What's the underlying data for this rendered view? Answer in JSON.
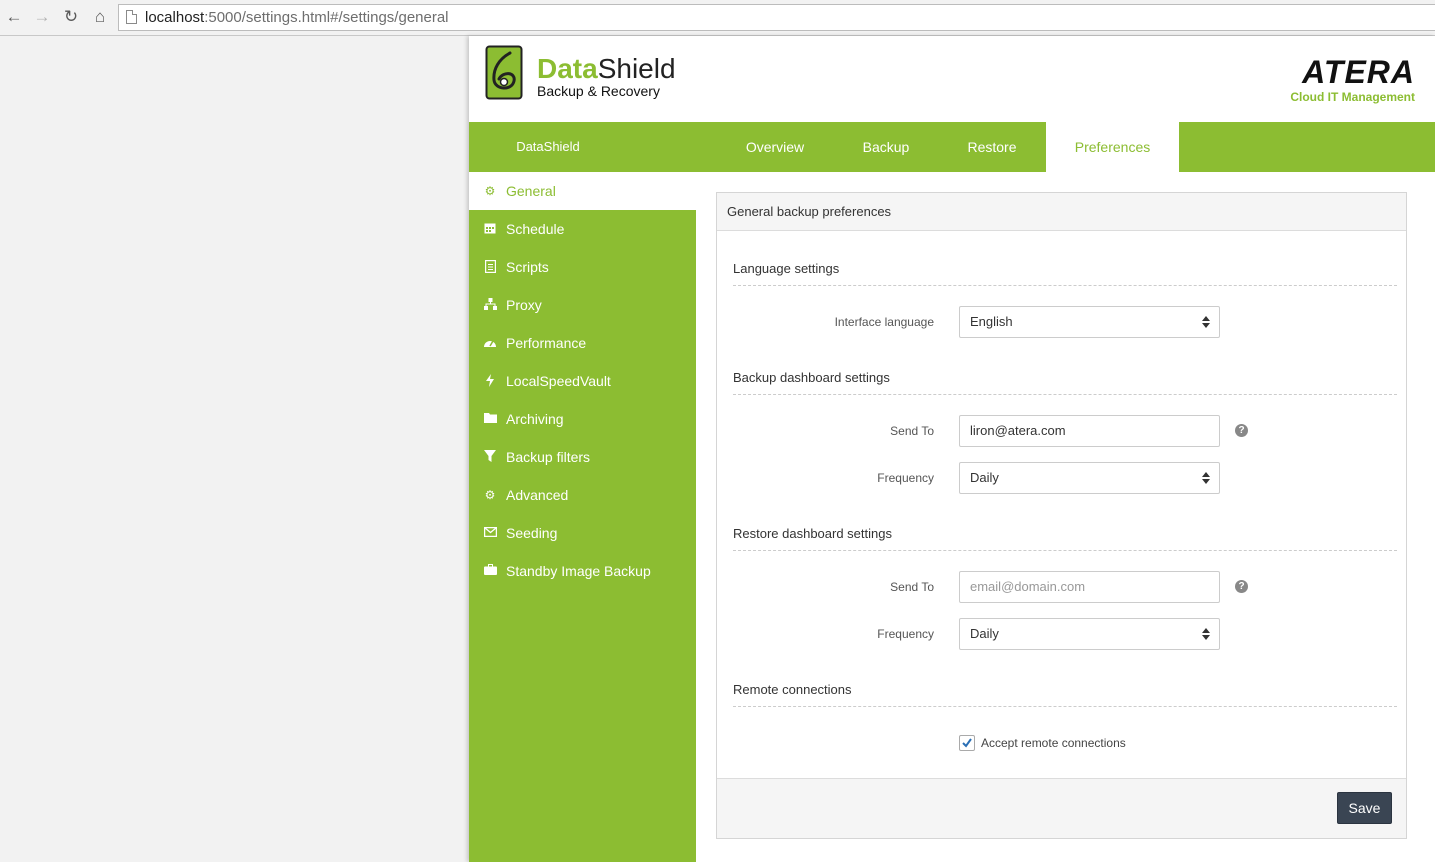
{
  "browser": {
    "url_host": "localhost",
    "url_rest": ":5000/settings.html#/settings/general"
  },
  "header": {
    "brand_data": "Data",
    "brand_shield": "Shield",
    "brand_sub": "Backup & Recovery",
    "partner_title": "ATERA",
    "partner_sub": "Cloud IT Management"
  },
  "top_nav": {
    "brand": "DataShield",
    "tabs": [
      {
        "label": "Overview"
      },
      {
        "label": "Backup"
      },
      {
        "label": "Restore"
      },
      {
        "label": "Preferences",
        "active": true
      }
    ]
  },
  "sidebar": {
    "items": [
      {
        "label": "General",
        "icon": "gear-icon",
        "active": true
      },
      {
        "label": "Schedule",
        "icon": "calendar-icon"
      },
      {
        "label": "Scripts",
        "icon": "document-icon"
      },
      {
        "label": "Proxy",
        "icon": "sitemap-icon"
      },
      {
        "label": "Performance",
        "icon": "dashboard-icon"
      },
      {
        "label": "LocalSpeedVault",
        "icon": "bolt-icon"
      },
      {
        "label": "Archiving",
        "icon": "folder-icon"
      },
      {
        "label": "Backup filters",
        "icon": "filter-icon"
      },
      {
        "label": "Advanced",
        "icon": "gears-icon"
      },
      {
        "label": "Seeding",
        "icon": "envelope-icon"
      },
      {
        "label": "Standby Image Backup",
        "icon": "briefcase-icon"
      }
    ]
  },
  "panel": {
    "title": "General backup preferences",
    "language": {
      "section": "Language settings",
      "label": "Interface language",
      "value": "English"
    },
    "backup_dashboard": {
      "section": "Backup dashboard settings",
      "send_to_label": "Send To",
      "send_to_value": "liron@atera.com",
      "frequency_label": "Frequency",
      "frequency_value": "Daily"
    },
    "restore_dashboard": {
      "section": "Restore dashboard settings",
      "send_to_label": "Send To",
      "send_to_placeholder": "email@domain.com",
      "frequency_label": "Frequency",
      "frequency_value": "Daily"
    },
    "remote": {
      "section": "Remote connections",
      "checkbox_label": "Accept remote connections",
      "checked": true
    },
    "save_label": "Save",
    "help_glyph": "?"
  },
  "colors": {
    "accent": "#8cbd32",
    "button_dark": "#3a4553"
  }
}
